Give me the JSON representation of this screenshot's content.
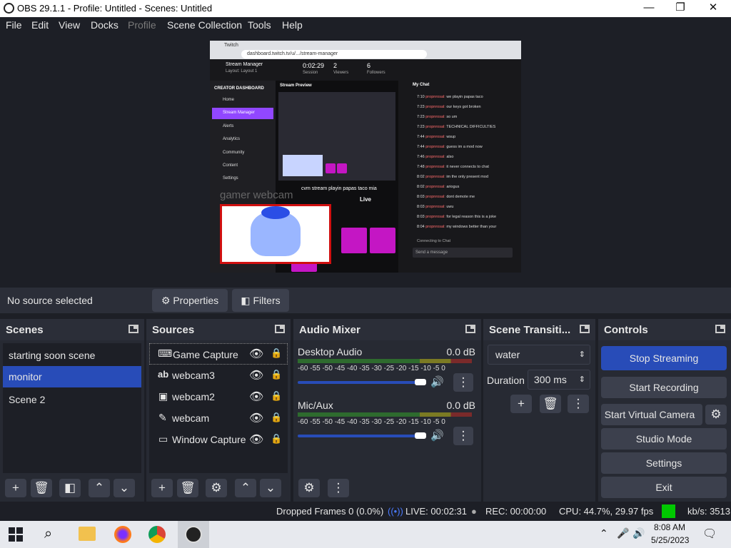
{
  "window": {
    "title": "OBS 29.1.1 - Profile: Untitled - Scenes: Untitled",
    "minimize": "—",
    "maximize": "❐",
    "close": "✕"
  },
  "menu": [
    "File",
    "Edit",
    "View",
    "Docks",
    "Profile",
    "Scene Collection",
    "Tools",
    "Help"
  ],
  "preview": {
    "url": "dashboard.twitch.tv/u/.../stream-manager",
    "tab_label": "Twitch",
    "header": {
      "title": "Stream Manager",
      "layout": "Layout: Layout 1",
      "session": "0:02:29",
      "session_label": "Session",
      "viewers": "2",
      "viewers_label": "Viewers",
      "followers": "6",
      "followers_label": "Followers"
    },
    "sidebar_heading": "CREATOR DASHBOARD",
    "sidebar_items": [
      "Home",
      "Stream Manager",
      "Alerts",
      "Analytics",
      "Community",
      "Content",
      "Settings"
    ],
    "stream_preview_label": "Stream Preview",
    "stream_title": "cvm stream playin papas taco mia",
    "live_label": "Live",
    "watermark": "gamer webcam",
    "chat_title": "My Chat",
    "chat_lines": [
      {
        "time": "7:10",
        "user": "propnrosal:",
        "msg": "we playin papas taco"
      },
      {
        "time": "7:23",
        "user": "propnrosal:",
        "msg": "our keys got broken"
      },
      {
        "time": "7:23",
        "user": "propnrosal:",
        "msg": "so um"
      },
      {
        "time": "7:23",
        "user": "propnrosal:",
        "msg": "TECHNICAL DIFFICULTIES"
      },
      {
        "time": "7:44",
        "user": "propnrosal:",
        "msg": "wsup"
      },
      {
        "time": "7:44",
        "user": "propnrosal:",
        "msg": "guess im a mod now"
      },
      {
        "time": "7:46",
        "user": "propnrosal:",
        "msg": "also"
      },
      {
        "time": "7:48",
        "user": "propnrosal:",
        "msg": "it never connects to chat"
      },
      {
        "time": "8:02",
        "user": "propnrosal:",
        "msg": "im the only present mod"
      },
      {
        "time": "8:02",
        "user": "propnrosal:",
        "msg": "ariogus"
      },
      {
        "time": "8:03",
        "user": "propnrosal:",
        "msg": "dont demote me"
      },
      {
        "time": "8:03",
        "user": "propnrosal:",
        "msg": "uwu"
      },
      {
        "time": "8:03",
        "user": "propnrosal:",
        "msg": "for legal reason this is a joke"
      },
      {
        "time": "8:04",
        "user": "propnrosal:",
        "msg": "my windows better than your"
      }
    ],
    "connecting": "Connecting to Chat",
    "send_placeholder": "Send a message"
  },
  "source_bar": {
    "status": "No source selected",
    "properties": "Properties",
    "filters": "Filters"
  },
  "scenes": {
    "title": "Scenes",
    "items": [
      "starting soon scene",
      "monitor",
      "Scene 2"
    ],
    "selected": 1
  },
  "sources": {
    "title": "Sources",
    "items": [
      {
        "name": "Game Capture",
        "icon": "gamepad-icon"
      },
      {
        "name": "webcam3",
        "icon": "text-icon"
      },
      {
        "name": "webcam2",
        "icon": "image-icon"
      },
      {
        "name": "webcam",
        "icon": "brush-icon"
      },
      {
        "name": "Window Capture",
        "icon": "window-icon"
      }
    ]
  },
  "audio": {
    "title": "Audio Mixer",
    "channels": [
      {
        "name": "Desktop Audio",
        "db": "0.0 dB",
        "volume": 1.0
      },
      {
        "name": "Mic/Aux",
        "db": "0.0 dB",
        "volume": 1.0
      }
    ],
    "scale": [
      "-60",
      "-55",
      "-50",
      "-45",
      "-40",
      "-35",
      "-30",
      "-25",
      "-20",
      "-15",
      "-10",
      "-5",
      "0"
    ]
  },
  "transitions": {
    "title": "Scene Transiti...",
    "selected": "water",
    "duration_label": "Duration",
    "duration": "300 ms"
  },
  "controls": {
    "title": "Controls",
    "stop_streaming": "Stop Streaming",
    "start_recording": "Start Recording",
    "virtual_camera": "Start Virtual Camera",
    "studio_mode": "Studio Mode",
    "settings": "Settings",
    "exit": "Exit"
  },
  "status": {
    "dropped": "Dropped Frames 0 (0.0%)",
    "live": "LIVE: 00:02:31",
    "rec": "REC: 00:00:00",
    "cpu": "CPU: 44.7%, 29.97 fps",
    "kbs": "kb/s: 3513",
    "indicator_color": "#00c800"
  },
  "taskbar": {
    "time": "8:08 AM",
    "date": "5/25/2023"
  },
  "colors": {
    "accent": "#284cb8",
    "twitch": "#9147ff"
  }
}
